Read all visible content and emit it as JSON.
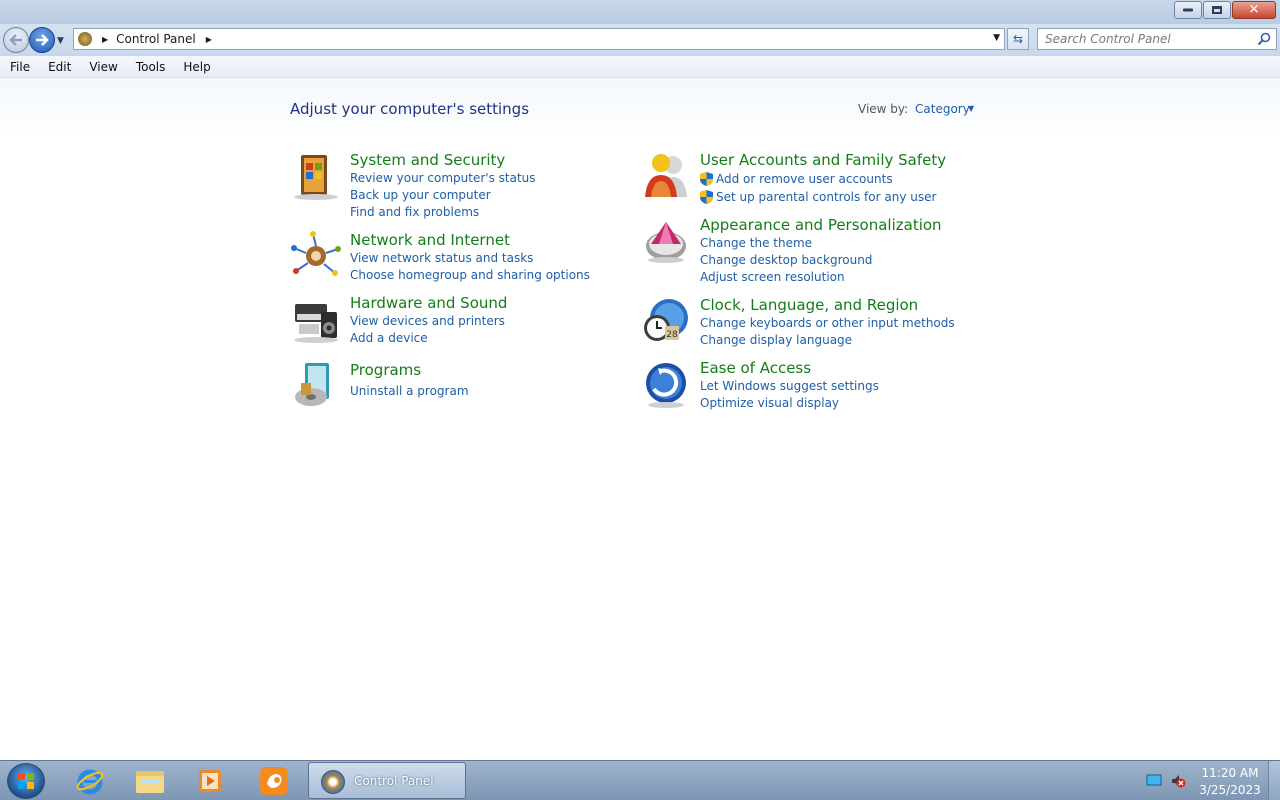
{
  "window": {
    "controls": {
      "minimize": "minimize",
      "maximize": "maximize",
      "close": "✕"
    }
  },
  "nav": {
    "address": {
      "items": [
        "Control Panel"
      ]
    },
    "search": {
      "placeholder": "Search Control Panel"
    }
  },
  "menu": {
    "items": [
      "File",
      "Edit",
      "View",
      "Tools",
      "Help"
    ]
  },
  "content": {
    "title": "Adjust your computer's settings",
    "view_by": {
      "label": "View by:",
      "value": "Category"
    },
    "categories": [
      {
        "title": "System and Security",
        "icon": "system-security-icon",
        "links": [
          "Review your computer's status",
          "Back up your computer",
          "Find and fix problems"
        ]
      },
      {
        "title": "Network and Internet",
        "icon": "network-internet-icon",
        "links": [
          "View network status and tasks",
          "Choose homegroup and sharing options"
        ]
      },
      {
        "title": "Hardware and Sound",
        "icon": "hardware-sound-icon",
        "links": [
          "View devices and printers",
          "Add a device"
        ]
      },
      {
        "title": "Programs",
        "icon": "programs-icon",
        "links": [
          "Uninstall a program"
        ]
      },
      {
        "title": "User Accounts and Family Safety",
        "icon": "user-accounts-icon",
        "links": [
          "Add or remove user accounts",
          "Set up parental controls for any user"
        ]
      },
      {
        "title": "Appearance and Personalization",
        "icon": "appearance-icon",
        "links": [
          "Change the theme",
          "Change desktop background",
          "Adjust screen resolution"
        ]
      },
      {
        "title": "Clock, Language, and Region",
        "icon": "clock-language-icon",
        "links": [
          "Change keyboards or other input methods",
          "Change display language"
        ]
      },
      {
        "title": "Ease of Access",
        "icon": "ease-of-access-icon",
        "links": [
          "Let Windows suggest settings",
          "Optimize visual display"
        ]
      }
    ]
  },
  "taskbar": {
    "active_window": "Control Panel",
    "clock": {
      "time": "11:20 AM",
      "date": "3/25/2023"
    }
  },
  "colors": {
    "category_title": "#137e17",
    "link": "#1e5fa8",
    "heading": "#1e3287"
  }
}
